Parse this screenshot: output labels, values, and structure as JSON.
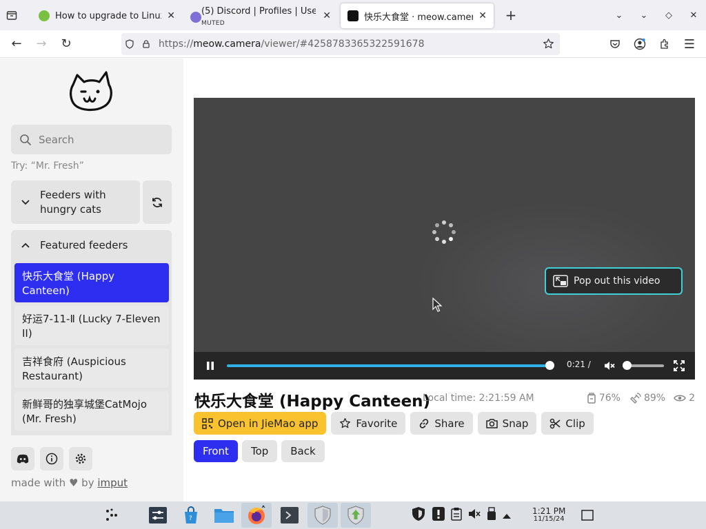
{
  "browser": {
    "tabs": [
      {
        "title": "How to upgrade to Linux M",
        "favicon_color": "#7bc043"
      },
      {
        "title": "(5) Discord | Profiles | Use",
        "sub": "MUTED",
        "favicon_color": "#7f70d8"
      },
      {
        "title": "快乐大食堂 · meow.camera",
        "favicon_color": "#111111"
      }
    ],
    "url_host": "meow.camera",
    "url_prefix": "https://",
    "url_rest": "/viewer/#4258783365322591678"
  },
  "sidebar": {
    "search_placeholder": "Search",
    "try_hint": "Try: “Mr. Fresh”",
    "section_hungry": "Feeders with hungry cats",
    "section_featured": "Featured feeders",
    "feeders": [
      {
        "label": "快乐大食堂 (Happy Canteen)",
        "selected": true
      },
      {
        "label": "好运7-11-Ⅱ (Lucky 7-Eleven II)",
        "selected": false
      },
      {
        "label": "吉祥食府 (Auspicious Restaurant)",
        "selected": false
      },
      {
        "label": "新鲜哥的独享城堡CatMojo (Mr. Fresh)",
        "selected": false
      }
    ],
    "made_with_prefix": "made with",
    "made_with_by": "by",
    "made_with_author": "imput"
  },
  "player": {
    "popout_label": "Pop out this video",
    "time": "0:21 /",
    "progress_fraction": 0.98,
    "volume_fraction": 0.0
  },
  "feeder": {
    "title": "快乐大食堂 (Happy Canteen)",
    "local_time": "Local time: 2:21:59 AM",
    "food_pct": "76%",
    "battery_pct": "89%",
    "viewers": "2"
  },
  "actions": {
    "open_app": "Open in JieMao app",
    "favorite": "Favorite",
    "share": "Share",
    "snap": "Snap",
    "clip": "Clip"
  },
  "views": {
    "front": "Front",
    "top": "Top",
    "back": "Back"
  },
  "taskbar": {
    "time": "1:21 PM",
    "date": "11/15/24"
  },
  "colors": {
    "accent": "#2d2ef0",
    "yellow": "#fbc22f",
    "progress": "#2db1e8",
    "popout_border": "#3fd0d8"
  }
}
